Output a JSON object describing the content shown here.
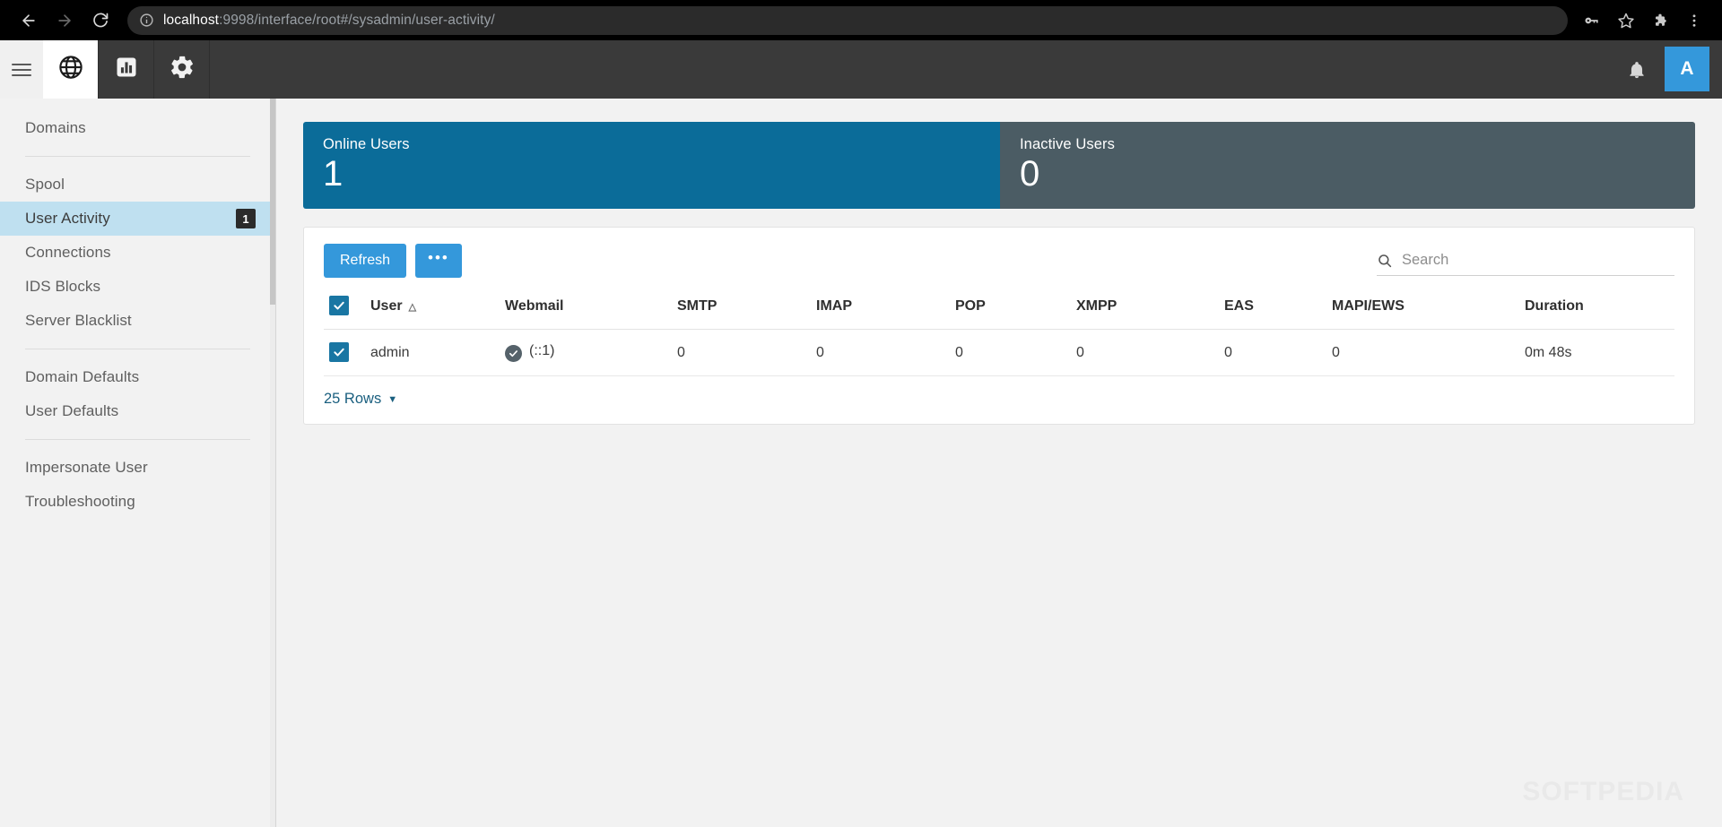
{
  "browser": {
    "back_label": "back-arrow",
    "forward_label": "forward-arrow",
    "reload_label": "reload",
    "url_host": "localhost",
    "url_rest": ":9998/interface/root#/sysadmin/user-activity/",
    "actions": [
      "password-key-icon",
      "bookmark-star-icon",
      "extensions-puzzle-icon",
      "chrome-menu-icon"
    ]
  },
  "app_header": {
    "menu_icon": "hamburger-menu-icon",
    "tabs": [
      {
        "icon": "globe-icon",
        "name": "domains-tab",
        "active": true
      },
      {
        "icon": "bar-chart-icon",
        "name": "reports-tab",
        "active": false
      },
      {
        "icon": "gear-icon",
        "name": "settings-tab",
        "active": false
      }
    ],
    "notifications_icon": "bell-icon",
    "avatar_initial": "A"
  },
  "sidebar": {
    "groups": [
      {
        "items": [
          {
            "label": "Domains",
            "active": false,
            "badge": null
          }
        ]
      },
      {
        "items": [
          {
            "label": "Spool",
            "active": false,
            "badge": null
          },
          {
            "label": "User Activity",
            "active": true,
            "badge": "1"
          },
          {
            "label": "Connections",
            "active": false,
            "badge": null
          },
          {
            "label": "IDS Blocks",
            "active": false,
            "badge": null
          },
          {
            "label": "Server Blacklist",
            "active": false,
            "badge": null
          }
        ]
      },
      {
        "items": [
          {
            "label": "Domain Defaults",
            "active": false,
            "badge": null
          },
          {
            "label": "User Defaults",
            "active": false,
            "badge": null
          }
        ]
      },
      {
        "items": [
          {
            "label": "Impersonate User",
            "active": false,
            "badge": null
          },
          {
            "label": "Troubleshooting",
            "active": false,
            "badge": null
          }
        ]
      }
    ]
  },
  "stats": [
    {
      "label": "Online Users",
      "value": "1",
      "style": "primary"
    },
    {
      "label": "Inactive Users",
      "value": "0",
      "style": "muted"
    }
  ],
  "toolbar": {
    "refresh_label": "Refresh",
    "more_label": "•••",
    "search_placeholder": "Search",
    "search_value": ""
  },
  "table": {
    "columns": [
      {
        "key": "check",
        "label": "",
        "sort": null
      },
      {
        "key": "user",
        "label": "User",
        "sort": "asc"
      },
      {
        "key": "webmail",
        "label": "Webmail",
        "sort": null
      },
      {
        "key": "smtp",
        "label": "SMTP",
        "sort": null
      },
      {
        "key": "imap",
        "label": "IMAP",
        "sort": null
      },
      {
        "key": "pop",
        "label": "POP",
        "sort": null
      },
      {
        "key": "xmpp",
        "label": "XMPP",
        "sort": null
      },
      {
        "key": "eas",
        "label": "EAS",
        "sort": null
      },
      {
        "key": "mapi",
        "label": "MAPI/EWS",
        "sort": null
      },
      {
        "key": "duration",
        "label": "Duration",
        "sort": null
      }
    ],
    "header_checked": true,
    "sort_caret": "△",
    "rows": [
      {
        "checked": true,
        "user": "admin",
        "webmail_status_icon": "check-circle-icon",
        "webmail": "(::1)",
        "smtp": "0",
        "imap": "0",
        "pop": "0",
        "xmpp": "0",
        "eas": "0",
        "mapi": "0",
        "duration": "0m 48s"
      }
    ],
    "rows_per_page": "25 Rows",
    "rows_caret": "▼"
  },
  "watermark": "SOFTPEDIA",
  "colors": {
    "accent_blue": "#3498db",
    "card_primary": "#0b6c99",
    "card_muted": "#4b5c64",
    "sidebar_active": "#bfe0f0",
    "checkbox": "#1976a3"
  }
}
